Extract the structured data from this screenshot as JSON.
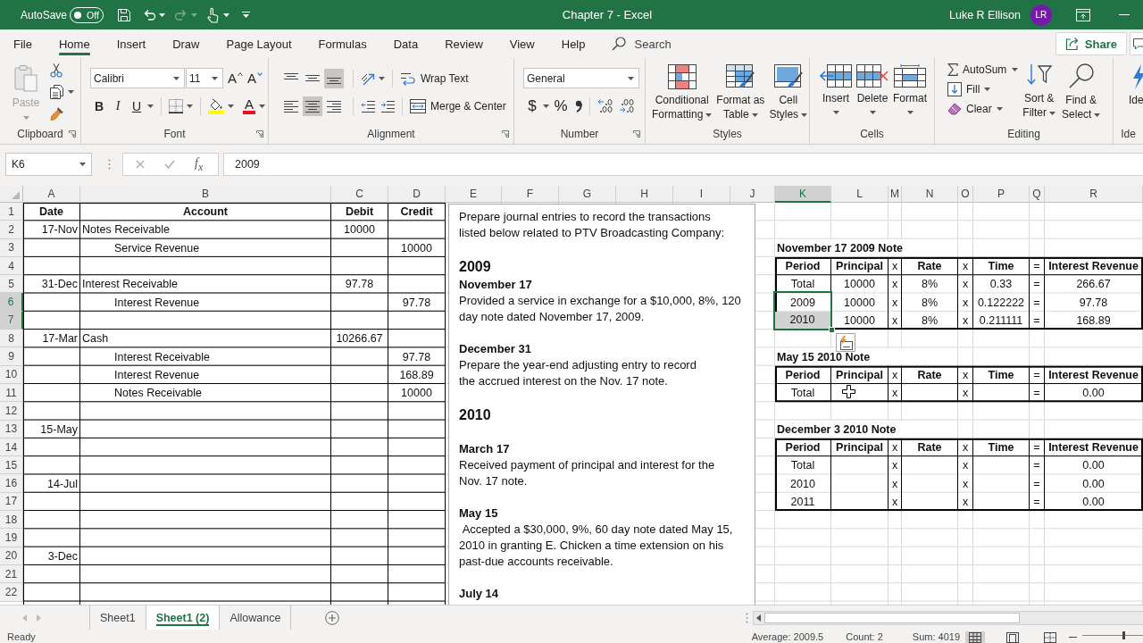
{
  "title_bar": {
    "autosave_label": "AutoSave",
    "autosave": {
      "label": "Off",
      "on": false
    },
    "redo": {
      "disabled": true
    },
    "title": "Chapter 7 - Excel",
    "user_name": "Luke R Ellison",
    "user_initials": "LR"
  },
  "menu_tabs": [
    {
      "label": "File",
      "selected": false
    },
    {
      "label": "Home",
      "selected": true
    },
    {
      "label": "Insert",
      "selected": false
    },
    {
      "label": "Draw",
      "selected": false
    },
    {
      "label": "Page Layout",
      "selected": false
    },
    {
      "label": "Formulas",
      "selected": false
    },
    {
      "label": "Data",
      "selected": false
    },
    {
      "label": "Review",
      "selected": false
    },
    {
      "label": "View",
      "selected": false
    },
    {
      "label": "Help",
      "selected": false
    }
  ],
  "search": {
    "placeholder": "Search"
  },
  "share_button": {
    "label": "Share"
  },
  "ribbon": {
    "clipboard": {
      "label": "Clipboard",
      "paste": {
        "label": "Paste",
        "disabled": true
      }
    },
    "font": {
      "label": "Font",
      "font_name": "Calibri",
      "font_size": "11",
      "grow_font": "A",
      "shrink_font": "A",
      "bold": "B",
      "italic": "I",
      "underline": "U",
      "font_color": "A"
    },
    "alignment": {
      "label": "Alignment",
      "vertical": [
        {
          "selected": false
        },
        {
          "selected": false
        },
        {
          "selected": true
        }
      ],
      "horizontal": [
        {
          "selected": false
        },
        {
          "selected": true
        },
        {
          "selected": false
        }
      ],
      "wrap_text": "Wrap Text",
      "merge_center": "Merge & Center"
    },
    "number": {
      "label": "Number",
      "format": "General",
      "currency": "$",
      "percent": "%"
    },
    "styles": {
      "label": "Styles",
      "buttons": [
        "Conditional\nFormatting",
        "Format as\nTable",
        "Cell\nStyles"
      ]
    },
    "cells": {
      "label": "Cells",
      "buttons": [
        "Insert",
        "Delete",
        "Format"
      ]
    },
    "editing": {
      "label": "Editing",
      "small_buttons": [
        "AutoSum",
        "Fill",
        "Clear"
      ],
      "large_buttons": [
        "Sort &\nFilter",
        "Find &\nSelect"
      ]
    },
    "ideas": {
      "label": "Ide",
      "button": "Ide"
    }
  },
  "formula_bar": {
    "name_box": "K6",
    "function_button": "f$_{x}$",
    "formula": "2009"
  },
  "sheet": {
    "columns": [
      {
        "label": "A",
        "selected": false
      },
      {
        "label": "B",
        "selected": false
      },
      {
        "label": "C",
        "selected": false
      },
      {
        "label": "D",
        "selected": false
      },
      {
        "label": "E",
        "selected": false
      },
      {
        "label": "F",
        "selected": false
      },
      {
        "label": "G",
        "selected": false
      },
      {
        "label": "H",
        "selected": false
      },
      {
        "label": "I",
        "selected": false
      },
      {
        "label": "J",
        "selected": false
      },
      {
        "label": "K",
        "selected": true
      },
      {
        "label": "L",
        "selected": false
      },
      {
        "label": "M",
        "selected": false
      },
      {
        "label": "N",
        "selected": false
      },
      {
        "label": "O",
        "selected": false
      },
      {
        "label": "P",
        "selected": false
      },
      {
        "label": "Q",
        "selected": false
      },
      {
        "label": "R",
        "selected": false
      }
    ],
    "journal_header": {
      "date": "Date",
      "account": "Account",
      "debit": "Debit",
      "credit": "Credit"
    },
    "rows": [
      {
        "label": "1",
        "selected": false
      },
      {
        "label": "2",
        "selected": false,
        "date": "17-Nov",
        "account": "Notes Receivable",
        "indented": false,
        "debit": "10000"
      },
      {
        "label": "3",
        "selected": false,
        "account": "Service Revenue",
        "indented": true,
        "credit": "10000"
      },
      {
        "label": "4",
        "selected": false
      },
      {
        "label": "5",
        "selected": false,
        "date": "31-Dec",
        "account": "Interest Receivable",
        "indented": false,
        "debit": "97.78"
      },
      {
        "label": "6",
        "selected": true,
        "account": "Interest Revenue",
        "indented": true,
        "credit": "97.78"
      },
      {
        "label": "7",
        "selected": true
      },
      {
        "label": "8",
        "selected": false,
        "date": "17-Mar",
        "account": "Cash",
        "indented": false,
        "debit": "10266.67"
      },
      {
        "label": "9",
        "selected": false,
        "account": "Interest Receivable",
        "indented": true,
        "credit": "97.78"
      },
      {
        "label": "10",
        "selected": false,
        "account": "Interest Revenue",
        "indented": true,
        "credit": "168.89"
      },
      {
        "label": "11",
        "selected": false,
        "account": "Notes Receivable",
        "indented": true,
        "credit": "10000"
      },
      {
        "label": "12",
        "selected": false
      },
      {
        "label": "13",
        "selected": false,
        "date": "15-May"
      },
      {
        "label": "14",
        "selected": false
      },
      {
        "label": "15",
        "selected": false
      },
      {
        "label": "16",
        "selected": false,
        "date": "14-Jul"
      },
      {
        "label": "17",
        "selected": false
      },
      {
        "label": "18",
        "selected": false
      },
      {
        "label": "19",
        "selected": false
      },
      {
        "label": "20",
        "selected": false,
        "date": "3-Dec"
      },
      {
        "label": "21",
        "selected": false
      },
      {
        "label": "22",
        "selected": false
      }
    ],
    "notes": [
      {
        "title": "November 17 2009 Note",
        "header": {
          "period": "Period",
          "principal": "Principal",
          "times_1": "x",
          "rate": "Rate",
          "times_2": "x",
          "time": "Time",
          "equals": "=",
          "interest_revenue": "Interest Revenue"
        },
        "rows": [
          {
            "period": "Total",
            "period_selected": false,
            "period_active": false,
            "principal": "10000",
            "times_1": "x",
            "rate": "8%",
            "times_2": "x",
            "time": "0.33",
            "equals": "=",
            "interest_revenue": "266.67"
          },
          {
            "period": "2009",
            "period_selected": true,
            "period_active": true,
            "principal": "10000",
            "times_1": "x",
            "rate": "8%",
            "times_2": "x",
            "time": "0.122222",
            "equals": "=",
            "interest_revenue": "97.78"
          },
          {
            "period": "2010",
            "period_selected": true,
            "period_active": false,
            "principal": "10000",
            "times_1": "x",
            "rate": "8%",
            "times_2": "x",
            "time": "0.211111",
            "equals": "=",
            "interest_revenue": "168.89"
          }
        ]
      },
      {
        "title": "May 15 2010 Note",
        "header": {
          "period": "Period",
          "principal": "Principal",
          "times_1": "x",
          "rate": "Rate",
          "times_2": "x",
          "time": "Time",
          "equals": "=",
          "interest_revenue": "Interest Revenue"
        },
        "rows": [
          {
            "period": "Total",
            "period_selected": false,
            "period_active": false,
            "times_1": "x",
            "times_2": "x",
            "equals": "=",
            "interest_revenue": "0.00"
          }
        ]
      },
      {
        "title": "December 3 2010 Note",
        "header": {
          "period": "Period",
          "principal": "Principal",
          "times_1": "x",
          "rate": "Rate",
          "times_2": "x",
          "time": "Time",
          "equals": "=",
          "interest_revenue": "Interest Revenue"
        },
        "rows": [
          {
            "period": "Total",
            "period_selected": false,
            "period_active": false,
            "times_1": "x",
            "times_2": "x",
            "equals": "=",
            "interest_revenue": "0.00"
          },
          {
            "period": "2010",
            "period_selected": false,
            "period_active": false,
            "times_1": "x",
            "times_2": "x",
            "equals": "=",
            "interest_revenue": "0.00"
          },
          {
            "period": "2011",
            "period_selected": false,
            "period_active": false,
            "times_1": "x",
            "times_2": "x",
            "equals": "=",
            "interest_revenue": "0.00"
          }
        ]
      }
    ],
    "text_box": {
      "paragraphs": [
        {
          "kind": "body",
          "text": "Prepare journal entries to record the transactions\nlisted below related to PTV Broadcasting Company:"
        },
        {
          "kind": "blank"
        },
        {
          "kind": "heading",
          "text": "2009"
        },
        {
          "kind": "subheading",
          "text": "November 17"
        },
        {
          "kind": "body",
          "text": "Provided a service in exchange for a $10,000, 8%, 120 day note dated November 17, 2009."
        },
        {
          "kind": "blank"
        },
        {
          "kind": "subheading",
          "text": "December 31"
        },
        {
          "kind": "body",
          "text": "Prepare the year-end adjusting entry to record\nthe accrued interest on the Nov. 17 note."
        },
        {
          "kind": "blank"
        },
        {
          "kind": "heading",
          "text": "2010"
        },
        {
          "kind": "blank"
        },
        {
          "kind": "subheading",
          "text": "March 17"
        },
        {
          "kind": "body",
          "text": "Received payment of principal and interest for the\nNov. 17 note."
        },
        {
          "kind": "blank"
        },
        {
          "kind": "subheading",
          "text": "May 15"
        },
        {
          "kind": "body",
          "text": " Accepted a $30,000, 9%, 60 day note dated May 15, 2010 in granting E. Chicken a time extension on his past-due accounts receivable."
        },
        {
          "kind": "blank"
        },
        {
          "kind": "subheading",
          "text": "July 14"
        }
      ]
    }
  },
  "sheet_tabs": [
    {
      "label": "Sheet1",
      "selected": false
    },
    {
      "label": "Sheet1 (2)",
      "selected": true
    },
    {
      "label": "Allowance",
      "selected": false
    }
  ],
  "status_bar": {
    "mode": "Ready",
    "average": "Average: 2009.5",
    "count": "Count: 2",
    "sum": "Sum: 4019",
    "views": [
      {
        "selected": true
      },
      {
        "selected": false
      },
      {
        "selected": false
      }
    ],
    "zoom": {
      "level": 0.68
    }
  }
}
